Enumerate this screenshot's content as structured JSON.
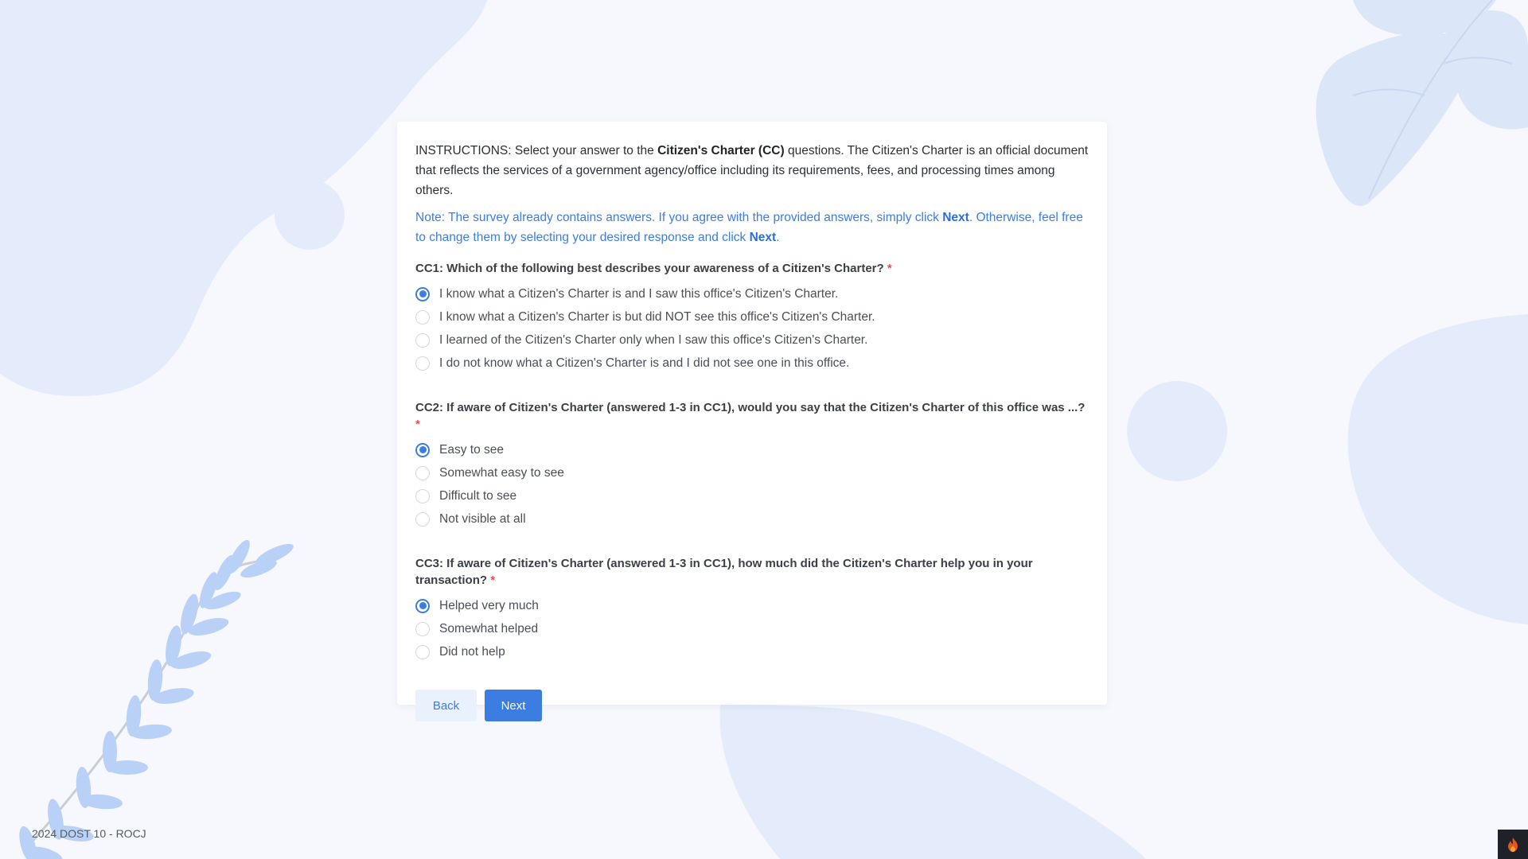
{
  "instructions": {
    "prefix": "INSTRUCTIONS: Select your answer to the ",
    "bold": "Citizen's Charter (CC)",
    "suffix": " questions. The Citizen's Charter is an official document that reflects the services of a government agency/office including its requirements, fees, and processing times among others."
  },
  "note": {
    "part1": "Note: The survey already contains answers. If you agree with the provided answers, simply click ",
    "next1": "Next",
    "part2": ". Otherwise, feel free to change them by selecting your desired response and click ",
    "next2": "Next",
    "part3": "."
  },
  "questions": [
    {
      "label": "CC1: Which of the following best describes your awareness of a Citizen's Charter?",
      "required_mark": "*",
      "options": [
        {
          "label": "I know what a Citizen's Charter is and I saw this office's Citizen's Charter.",
          "selected": true
        },
        {
          "label": "I know what a Citizen's Charter is but did NOT see this office's Citizen's Charter.",
          "selected": false
        },
        {
          "label": "I learned of the Citizen's Charter only when I saw this office's Citizen's Charter.",
          "selected": false
        },
        {
          "label": "I do not know what a Citizen's Charter is and I did not see one in this office.",
          "selected": false
        }
      ]
    },
    {
      "label": "CC2: If aware of Citizen's Charter (answered 1-3 in CC1), would you say that the Citizen's Charter of this office was ...?",
      "required_mark": "*",
      "options": [
        {
          "label": "Easy to see",
          "selected": true
        },
        {
          "label": "Somewhat easy to see",
          "selected": false
        },
        {
          "label": "Difficult to see",
          "selected": false
        },
        {
          "label": "Not visible at all",
          "selected": false
        }
      ]
    },
    {
      "label": "CC3: If aware of Citizen's Charter (answered 1-3 in CC1), how much did the Citizen's Charter help you in your transaction?",
      "required_mark": "*",
      "options": [
        {
          "label": "Helped very much",
          "selected": true
        },
        {
          "label": "Somewhat helped",
          "selected": false
        },
        {
          "label": "Did not help",
          "selected": false
        }
      ]
    }
  ],
  "buttons": {
    "back": "Back",
    "next": "Next"
  },
  "footer": "2024 DOST 10 - ROCJ",
  "colors": {
    "accent": "#3b7de0",
    "background": "#f6f8fd",
    "shapes": "#e4ecfb",
    "required": "#e05252"
  }
}
